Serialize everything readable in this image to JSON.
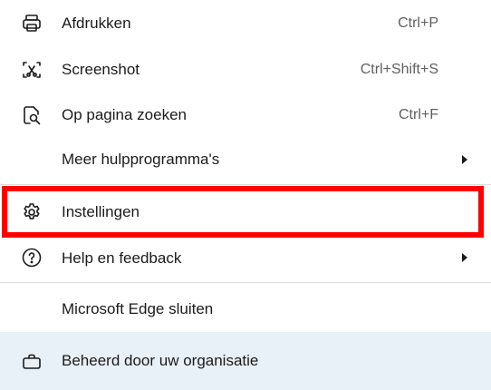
{
  "menu": {
    "print": {
      "label": "Afdrukken",
      "shortcut": "Ctrl+P",
      "icon": "printer-icon"
    },
    "screenshot": {
      "label": "Screenshot",
      "shortcut": "Ctrl+Shift+S",
      "icon": "screenshot-icon"
    },
    "find": {
      "label": "Op pagina zoeken",
      "shortcut": "Ctrl+F",
      "icon": "find-on-page-icon"
    },
    "more_tools": {
      "label": "Meer hulpprogramma's",
      "icon": "chevron-right-icon"
    },
    "settings": {
      "label": "Instellingen",
      "icon": "gear-icon"
    },
    "help": {
      "label": "Help en feedback",
      "icon": "question-circle-icon"
    },
    "close_edge": {
      "label": "Microsoft Edge sluiten"
    },
    "managed": {
      "label": "Beheerd door uw organisatie",
      "icon": "briefcase-icon"
    }
  },
  "colors": {
    "highlight": "#ff0000",
    "managed_bg": "#e8f0f8",
    "divider": "#dedede"
  }
}
